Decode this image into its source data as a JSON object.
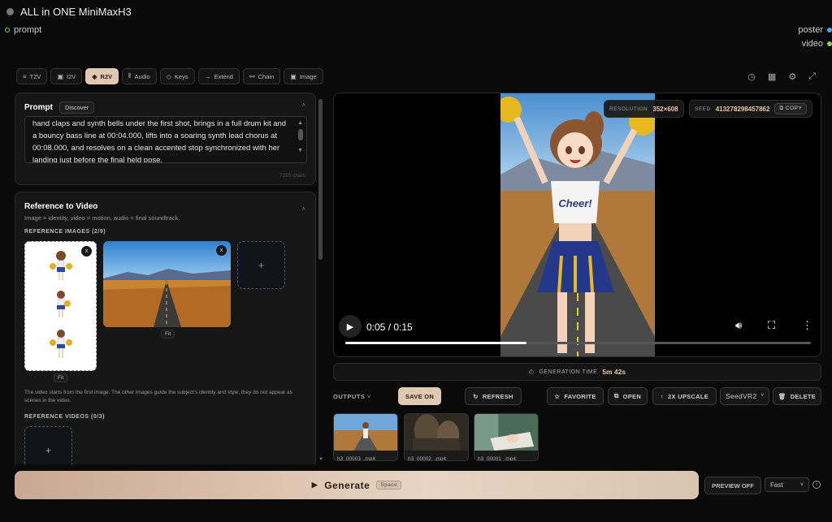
{
  "node": {
    "title": "ALL in ONE MiniMaxH3"
  },
  "io": {
    "input_prompt": "prompt",
    "output_poster": "poster",
    "output_video": "video"
  },
  "tabs": [
    {
      "label": "T2V",
      "icon": "list-icon"
    },
    {
      "label": "I2V",
      "icon": "image-icon"
    },
    {
      "label": "R2V",
      "icon": "layers-icon",
      "active": true
    },
    {
      "label": "Audio",
      "icon": "waveform-icon"
    },
    {
      "label": "Keys",
      "icon": "diamond-icon"
    },
    {
      "label": "Extend",
      "icon": "arrow-right-icon"
    },
    {
      "label": "Chain",
      "icon": "link-icon"
    },
    {
      "label": "Image",
      "icon": "image-icon"
    }
  ],
  "prompt_card": {
    "title": "Prompt",
    "discover_label": "Discover",
    "text": "hand claps and synth bells under the first shot, brings in a full drum kit and a bouncy bass line at 00:04.000, lifts into a soaring synth lead chorus at 00:08.000, and resolves on a clean accented stop synchronized with her landing just before the final held pose.",
    "char_count": "7255 chars"
  },
  "reference": {
    "title": "Reference to Video",
    "subtitle": "Image = identity, video = motion, audio = final soundtrack.",
    "images_label": "REFERENCE IMAGES (2/9)",
    "remove_label": "x",
    "fit_label": "Fit",
    "add_label": "+",
    "note": "The video starts from the first image. The other images guide the subject's identity and style, they do not appear as scenes in the video.",
    "videos_label": "REFERENCE VIDEOS (0/3)"
  },
  "video": {
    "resolution_label": "RESOLUTION",
    "resolution_value": "352×608",
    "seed_label": "SEED",
    "seed_value": "413278298457862",
    "copy_label": "COPY",
    "time": "0:05 / 0:15",
    "progress": 0.39
  },
  "generation": {
    "label": "GENERATION TIME",
    "value": "5m 42s"
  },
  "outputs": {
    "label": "OUTPUTS",
    "save_label": "SAVE ON",
    "refresh_label": "REFRESH",
    "favorite_label": "FAVORITE",
    "open_label": "OPEN",
    "upscale_label": "2X UPSCALE",
    "upscaler": "SeedVR2",
    "delete_label": "DELETE",
    "files": [
      "h3_00003_.mp4",
      "h3_00002_.mp4",
      "h3_00001_.mp4"
    ]
  },
  "footer": {
    "generate_label": "Generate",
    "shortcut": "Space",
    "preview_label": "PREVIEW OFF",
    "speed": "Fast",
    "info_label": "i"
  },
  "colors": {
    "accent": "#e0c8b3",
    "value_text": "#e6c9a8",
    "poster_dot": "#4aa3e8",
    "video_dot": "#8bd44a",
    "prompt_dot": "#8bd44a"
  }
}
